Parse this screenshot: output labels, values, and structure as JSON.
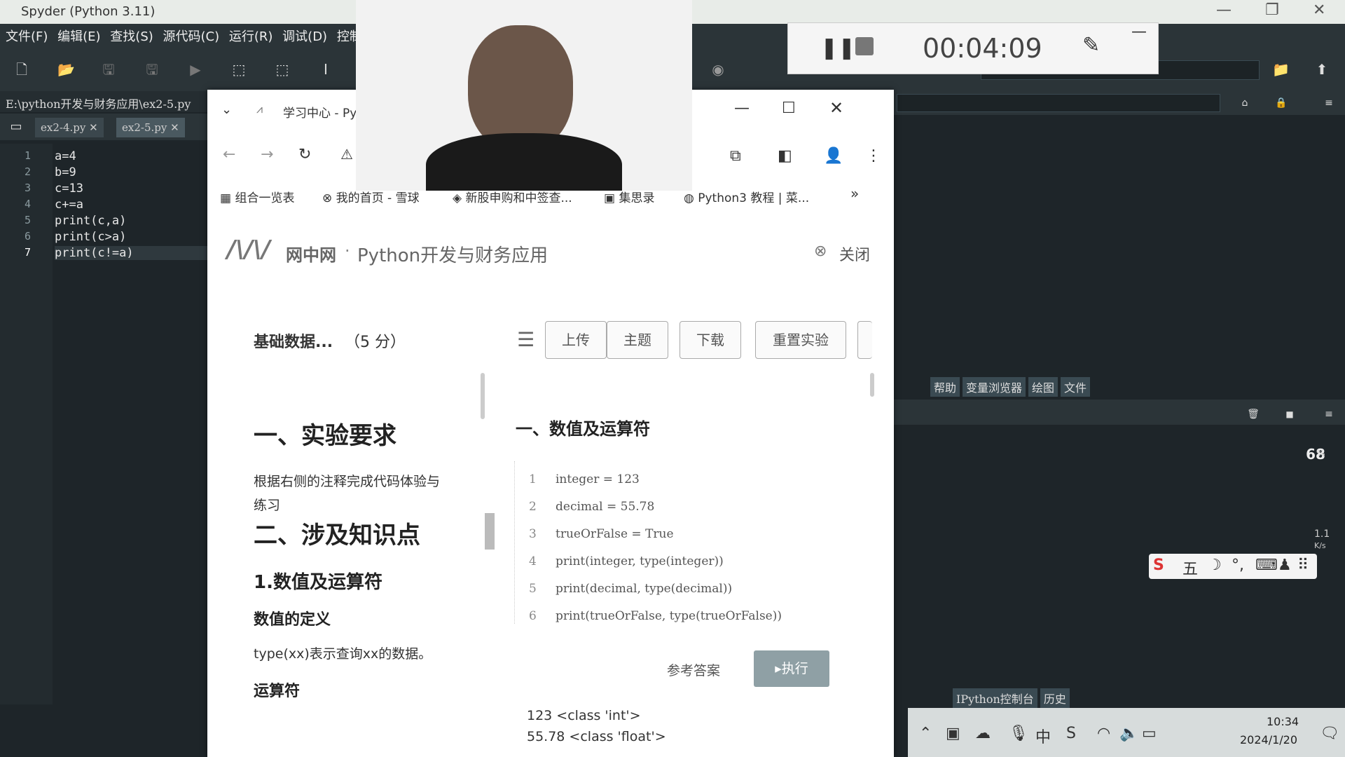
{
  "spyder": {
    "title": "Spyder (Python 3.11)",
    "menu": [
      "文件(F)",
      "编辑(E)",
      "查找(S)",
      "源代码(C)",
      "运行(R)",
      "调试(D)",
      "控制台(O)"
    ],
    "path": "E:\\python开发与财务应用\\ex2-5.py",
    "tabs": [
      "ex2-4.py",
      "ex2-5.py"
    ],
    "code_lines": [
      "a=4",
      "b=9",
      "c=13",
      "c+=a",
      "print(c,a)",
      "print(c>a)",
      "print(c!=a)"
    ],
    "current_line": 7,
    "help_tabs": [
      "帮助",
      "变量浏览器",
      "绘图",
      "文件"
    ],
    "console_tabs": [
      "IPython控制台",
      "历史"
    ]
  },
  "recorder": {
    "time": "00:04:09"
  },
  "browser": {
    "tab_title": "学习中心 - Py",
    "bookmarks": [
      "组合一览表",
      "我的首页 - 雪球",
      "新股申购和中签查...",
      "集思录",
      "Python3 教程 | 菜...",
      "»"
    ],
    "site_logo": "网中网",
    "site_title": "Python开发与财务应用",
    "close_label": "关闭",
    "lab_title": "基础数据...",
    "score": "（5 分）",
    "buttons": [
      "上传",
      "主题",
      "下载",
      "重置实验"
    ],
    "left": {
      "h1": "一、实验要求",
      "p1": "根据右侧的注释完成代码体验与练习",
      "h2": "二、涉及知识点",
      "h3": "1.数值及运算符",
      "h4": "数值的定义",
      "p2": "type(xx)表示查询xx的数据。",
      "h5": "运算符"
    },
    "right": {
      "heading": "一、数值及运算符",
      "code": [
        "integer = 123",
        "decimal = 55.78",
        "trueOrFalse = True",
        "print(integer, type(integer))",
        "print(decimal, type(decimal))",
        "print(trueOrFalse, type(trueOrFalse))"
      ],
      "answer_label": "参考答案",
      "run_label": "执行",
      "output": [
        "123 <class 'int'>",
        "55.78 <class 'float'>"
      ]
    }
  },
  "system": {
    "cpu_percent": "68",
    "net_up": "1.1",
    "net_unit": "K/s",
    "ime_mode": "五",
    "ime_lang": "中",
    "clock_time": "10:34",
    "clock_date": "2024/1/20"
  }
}
